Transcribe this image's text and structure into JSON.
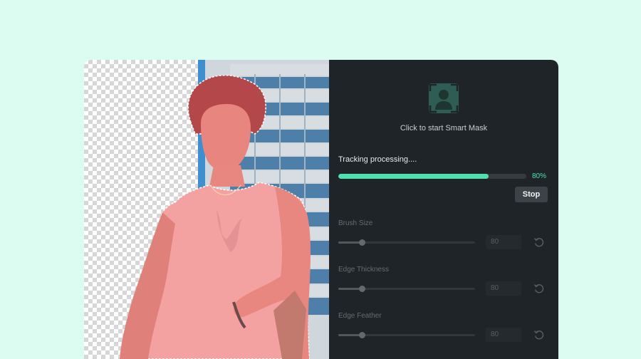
{
  "panel": {
    "smart_mask_icon": "portrait-frame-icon",
    "smart_mask_label": "Click to start Smart Mask",
    "tracking_label": "Tracking processing....",
    "progress_percent": 80,
    "progress_text": "80%",
    "stop_label": "Stop",
    "reset_icon": "reset-rotate-icon",
    "controls": [
      {
        "label": "Brush Size",
        "value": "80",
        "slider_level": 0.17
      },
      {
        "label": "Edge Thickness",
        "value": "80",
        "slider_level": 0.17
      },
      {
        "label": "Edge Feather",
        "value": "80",
        "slider_level": 0.17
      }
    ]
  },
  "colors": {
    "page_background": "#dcfbf1",
    "panel_background": "#1f2428",
    "accent": "#4fe0b0",
    "mask_overlay": "#f08a86"
  }
}
